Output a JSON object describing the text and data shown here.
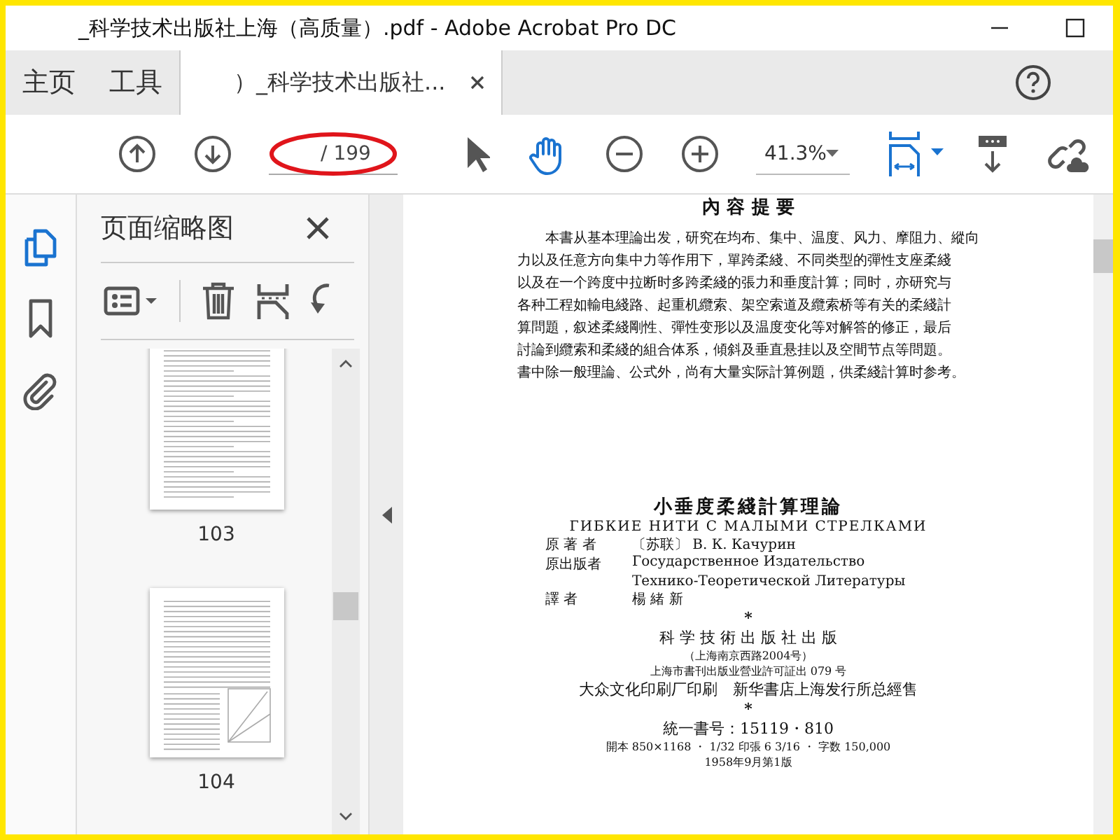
{
  "window": {
    "title": "_科学技术出版社上海（高质量）.pdf - Adobe Acrobat Pro DC"
  },
  "tabs": [
    {
      "label": "主页",
      "selected": false,
      "closable": false
    },
    {
      "label": "工具",
      "selected": false,
      "closable": false
    },
    {
      "label": "）_科学技术出版社...",
      "selected": true,
      "closable": true
    }
  ],
  "toolbar": {
    "page_total": "/ 199",
    "zoom": "41.3%"
  },
  "side_rail": [
    {
      "kind": "pages",
      "selected": true
    },
    {
      "kind": "bookmarks",
      "selected": false
    },
    {
      "kind": "attachments",
      "selected": false
    }
  ],
  "panel": {
    "title": "页面缩略图",
    "thumbnails": [
      {
        "label": "103",
        "kind": "text"
      },
      {
        "label": "104",
        "kind": "figure"
      }
    ]
  },
  "document": {
    "heading": "內 容 提 要",
    "summary": [
      "本書从基本理論出发，研究在均布、集中、温度、风力、摩阻力、縱向",
      "力以及任意方向集中力等作用下，單跨柔綫、不同类型的彈性支座柔綫",
      "以及在一个跨度中拉断时多跨柔綫的張力和垂度計算；同时，亦研究与",
      "各种工程如輸电綫路、起重机纜索、架空索道及纜索桥等有关的柔綫計",
      "算問題，叙述柔綫剛性、彈性变形以及温度变化等对解答的修正，最后",
      "討論到纜索和柔綫的組合体系，傾斜及垂直悬挂以及空間节点等問題。",
      "書中除一般理論、公式外，尚有大量实际計算例題，供柔綫計算时参考。"
    ],
    "imprint": [
      {
        "kind": "title",
        "text": "小垂度柔綫計算理論"
      },
      {
        "kind": "subtitle",
        "text": "ГИБКИЕ НИТИ С МАЛЫМИ СТРЕЛКАМИ"
      },
      {
        "kind": "credit",
        "label": "原 著 者",
        "text": "〔苏联〕 В. К. Качурин"
      },
      {
        "kind": "credit",
        "label": "原出版者",
        "text": "Государственное Издательство"
      },
      {
        "kind": "credit",
        "text": "Технико-Теоретической Литературы"
      },
      {
        "kind": "credit",
        "label": "譯 者",
        "text": "楊 緒 新"
      },
      {
        "kind": "mark",
        "text": "*"
      },
      {
        "kind": "line",
        "text": "科 学 技 術 出 版 社 出 版"
      },
      {
        "kind": "small",
        "text": "（上海南京西路2004号）"
      },
      {
        "kind": "small",
        "text": "上海市書刊出版业營业許可証出 079 号"
      },
      {
        "kind": "line",
        "text": "大众文化印刷厂印刷　新华書店上海发行所总經售"
      },
      {
        "kind": "mark",
        "text": "*"
      },
      {
        "kind": "line",
        "text": "統一書号：15119・810"
      },
      {
        "kind": "small",
        "text": "開本 850×1168 ・ 1/32 印張 6 3/16 ・ 字数 150,000"
      },
      {
        "kind": "small",
        "text": "1958年9月第1版"
      }
    ]
  }
}
